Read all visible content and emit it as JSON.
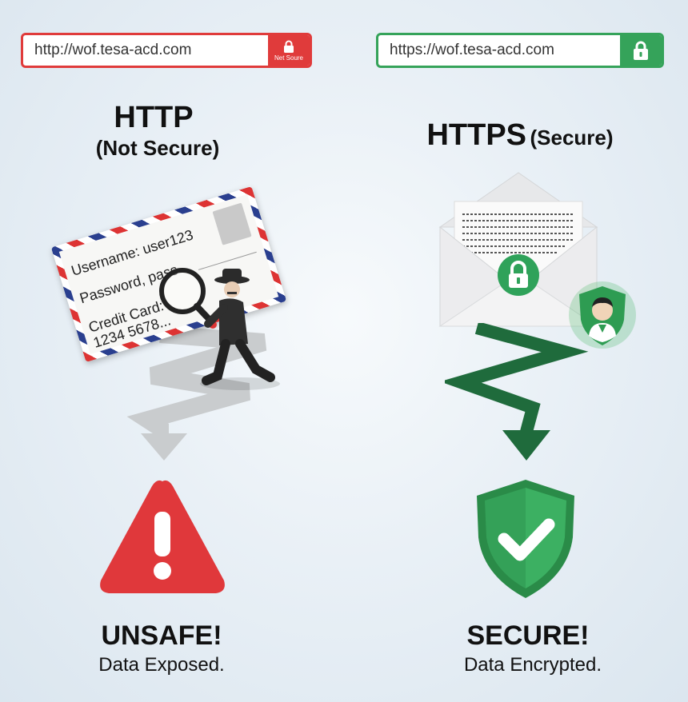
{
  "http": {
    "url": "http://wof.tesa-acd.com",
    "lock_label": "Net Soure",
    "title": "HTTP",
    "subtitle": "(Not Secure)",
    "envelope": {
      "line1": "Username: user123",
      "line2": "Password, pass",
      "line3": "Credit Card:",
      "line4": "1234 5678..."
    },
    "verdict": "UNSAFE!",
    "verdict_sub": "Data Exposed."
  },
  "https": {
    "url": "https://wof.tesa-acd.com",
    "title": "HTTPS",
    "title_suffix": "(Secure)",
    "verdict": "SECURE!",
    "verdict_sub": "Data Encrypted."
  },
  "colors": {
    "danger": "#e03b3b",
    "secure": "#35a35a",
    "dark_green": "#1f6b3c",
    "gray_path": "#c9ccce"
  },
  "icons": [
    "lock-icon",
    "magnifier-icon",
    "hacker-figure",
    "envelope-icon",
    "user-shield-icon",
    "warning-triangle-icon",
    "check-shield-icon",
    "arrow-down-icon"
  ]
}
